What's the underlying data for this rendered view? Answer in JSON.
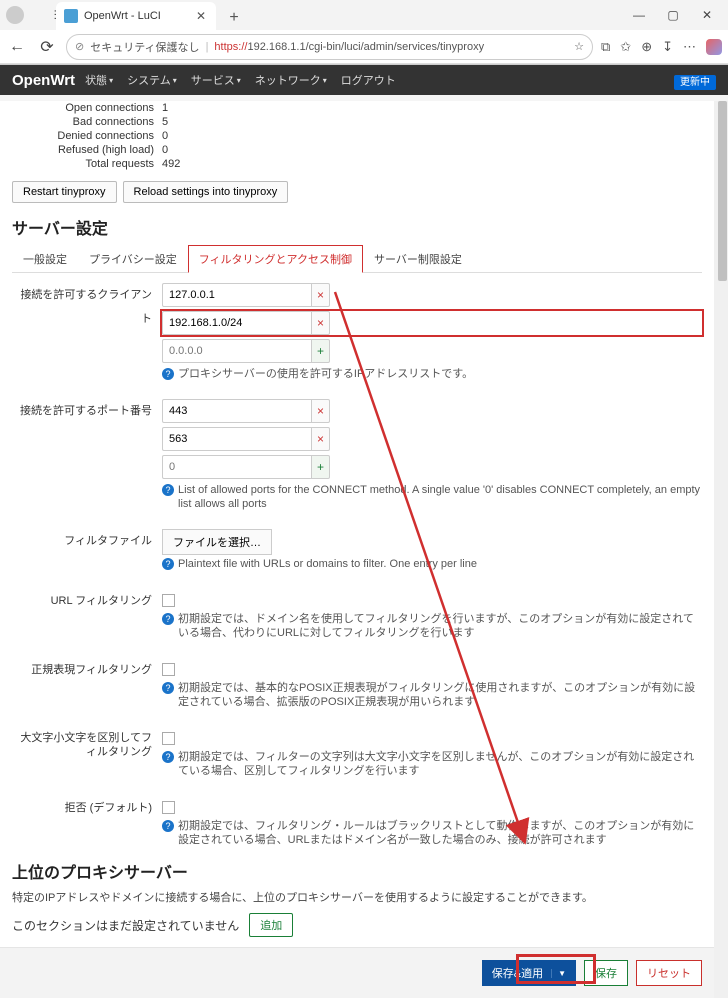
{
  "window": {
    "tab_title": "OpenWrt - LuCI",
    "url_warn": "セキュリティ保護なし",
    "url_https": "https://",
    "url_rest": "192.168.1.1/cgi-bin/luci/admin/services/tinyproxy"
  },
  "luci_header": {
    "brand": "OpenWrt",
    "status": "状態",
    "system": "システム",
    "services": "サービス",
    "network": "ネットワーク",
    "logout": "ログアウト",
    "updating": "更新中"
  },
  "stats": {
    "open_connections_label": "Open connections",
    "open_connections": "1",
    "bad_connections_label": "Bad connections",
    "bad_connections": "5",
    "denied_connections_label": "Denied connections",
    "denied_connections": "0",
    "refused_label": "Refused (high load)",
    "refused": "0",
    "total_requests_label": "Total requests",
    "total_requests": "492"
  },
  "buttons": {
    "restart": "Restart tinyproxy",
    "reload": "Reload settings into tinyproxy"
  },
  "section_server": "サーバー設定",
  "tabs": {
    "general": "一般設定",
    "privacy": "プライバシー設定",
    "filter": "フィルタリングとアクセス制御",
    "limits": "サーバー制限設定"
  },
  "form": {
    "allowed_clients_label": "接続を許可するクライアント",
    "client1": "127.0.0.1",
    "client2": "192.168.1.0/24",
    "client_add_ph": "0.0.0.0",
    "clients_help": "プロキシサーバーの使用を許可するIPアドレスリストです。",
    "allowed_ports_label": "接続を許可するポート番号",
    "port1": "443",
    "port2": "563",
    "port_add_ph": "0",
    "ports_help": "List of allowed ports for the CONNECT method. A single value '0' disables CONNECT completely, an empty list allows all ports",
    "filter_file_label": "フィルタファイル",
    "filter_file_btn": "ファイルを選択…",
    "filter_file_help": "Plaintext file with URLs or domains to filter. One entry per line",
    "url_filtering_label": "URL フィルタリング",
    "url_filtering_help": "初期設定では、ドメイン名を使用してフィルタリングを行いますが、このオプションが有効に設定されている場合、代わりにURLに対してフィルタリングを行います",
    "regex_filtering_label": "正規表現フィルタリング",
    "regex_filtering_help": "初期設定では、基本的なPOSIX正規表現がフィルタリングに使用されますが、このオプションが有効に設定されている場合、拡張版のPOSIX正規表現が用いられます",
    "case_label": "大文字小文字を区別してフィルタリング",
    "case_help": "初期設定では、フィルターの文字列は大文字小文字を区別しませんが、このオプションが有効に設定されている場合、区別してフィルタリングを行います",
    "deny_default_label": "拒否 (デフォルト)",
    "deny_default_help": "初期設定では、フィルタリング・ルールはブラックリストとして動作しますが、このオプションが有効に設定されている場合、URLまたはドメイン名が一致した場合のみ、接続が許可されます"
  },
  "upstream": {
    "heading": "上位のプロキシサーバー",
    "desc": "特定のIPアドレスやドメインに接続する場合に、上位のプロキシサーバーを使用するように設定することができます。",
    "none": "このセクションはまだ設定されていません",
    "add": "追加"
  },
  "footer": {
    "save_apply": "保存&適用",
    "save": "保存",
    "reset": "リセット"
  }
}
